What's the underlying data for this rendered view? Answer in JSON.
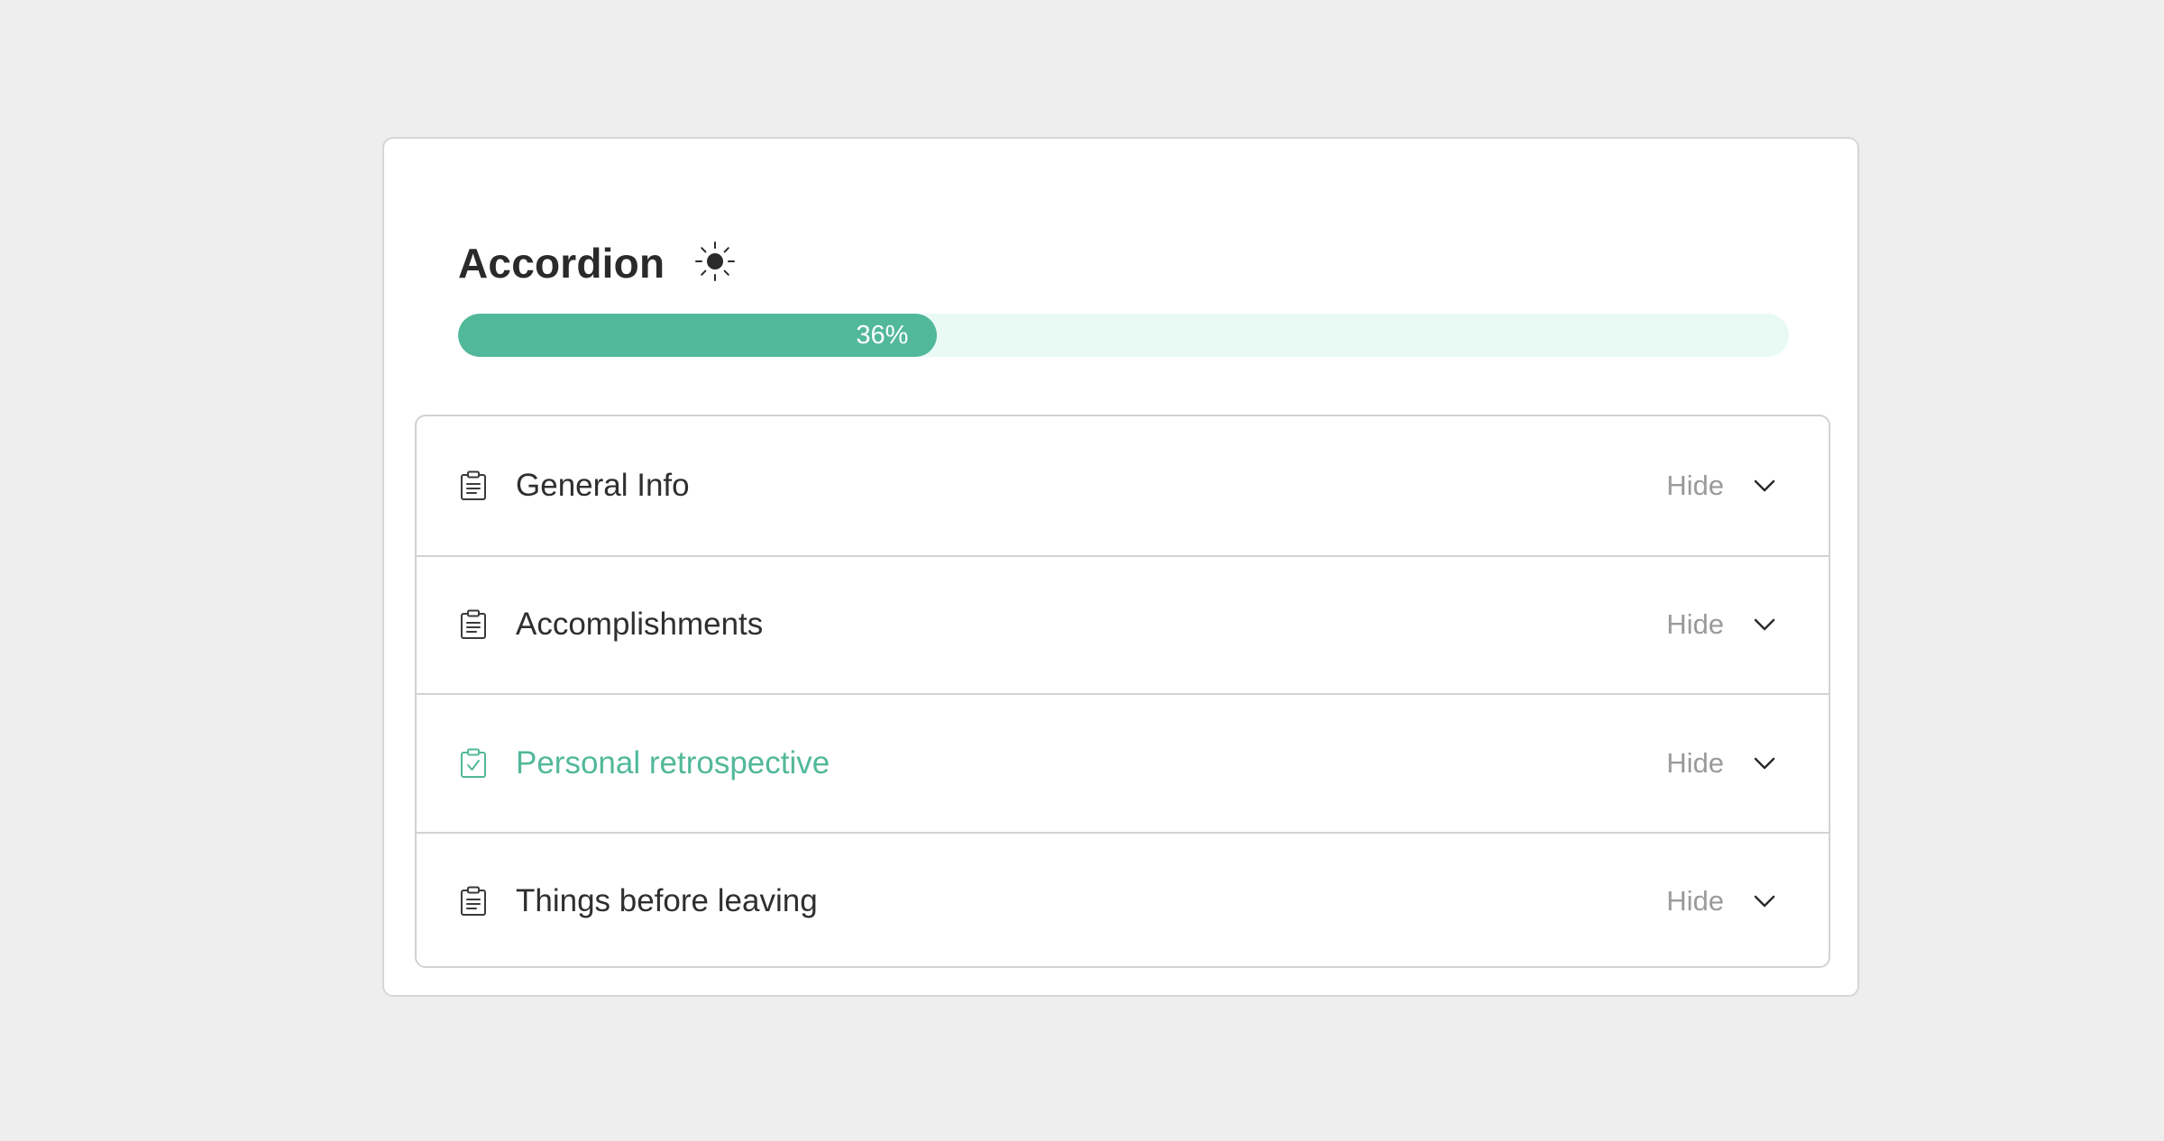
{
  "card": {
    "title": "Accordion",
    "theme_icon": "sun-icon"
  },
  "progress": {
    "percent": 36,
    "label": "36%",
    "fill_color": "#52b89a",
    "track_color": "#e9faf5"
  },
  "colors": {
    "accent": "#52b89a",
    "text": "#2f2f2f",
    "muted": "#9a9a9a"
  },
  "accordion": {
    "items": [
      {
        "label": "General Info",
        "toggle_label": "Hide",
        "icon": "clipboard-list-icon",
        "completed": false
      },
      {
        "label": "Accomplishments",
        "toggle_label": "Hide",
        "icon": "clipboard-list-icon",
        "completed": false
      },
      {
        "label": "Personal retrospective",
        "toggle_label": "Hide",
        "icon": "clipboard-check-icon",
        "completed": true
      },
      {
        "label": "Things before leaving",
        "toggle_label": "Hide",
        "icon": "clipboard-list-icon",
        "completed": false
      }
    ]
  }
}
